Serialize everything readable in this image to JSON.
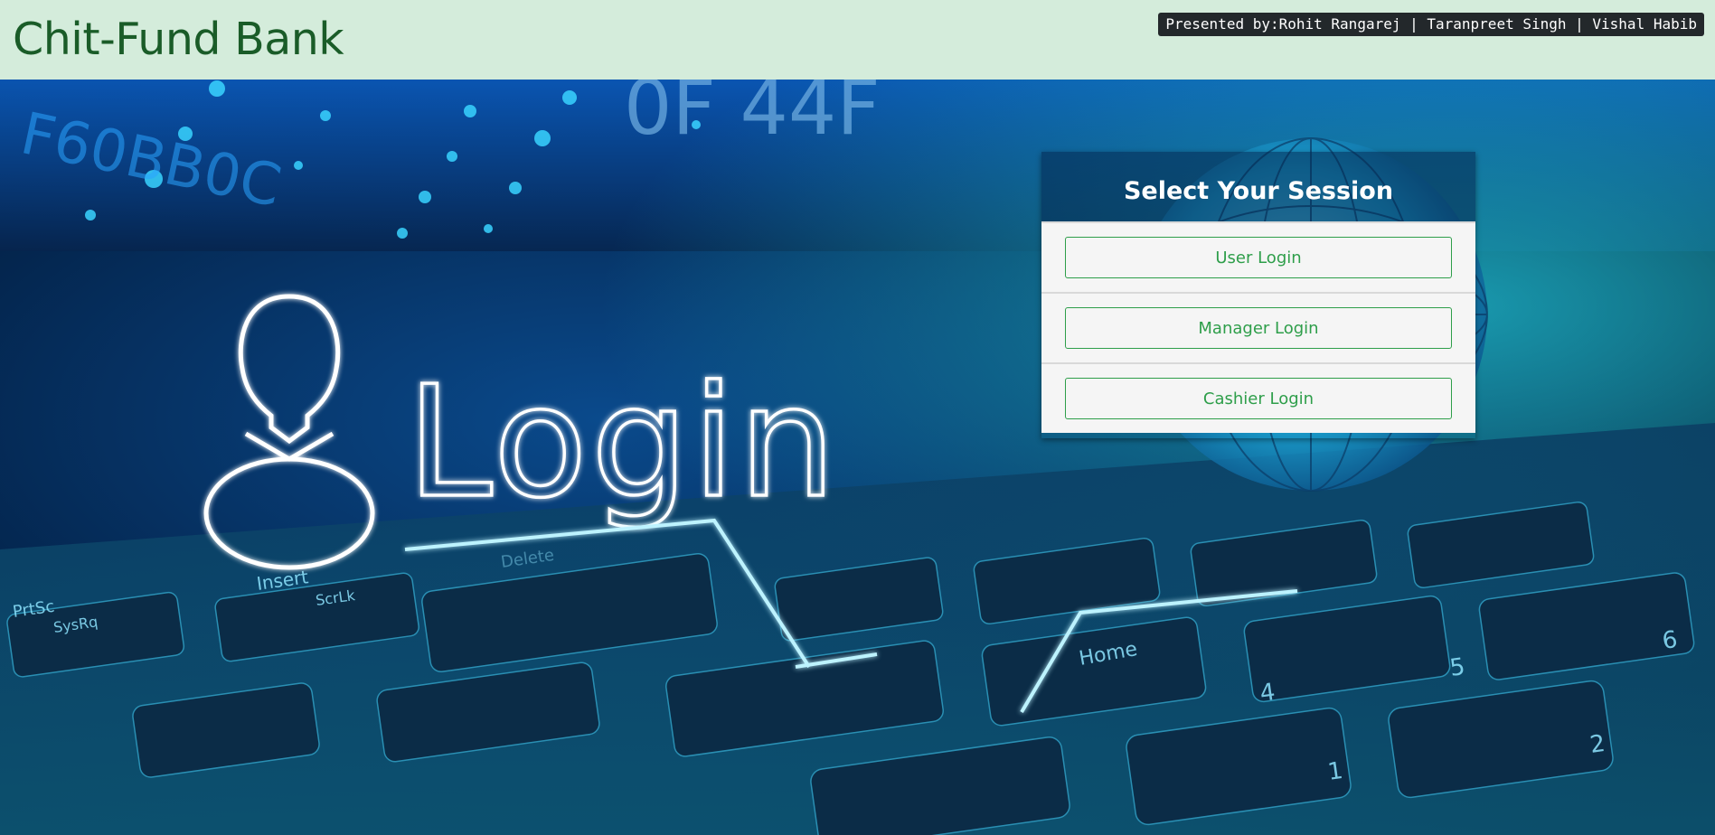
{
  "header": {
    "brand": "Chit-Fund Bank",
    "presenters": "Presented by:Rohit Rangarej | Taranpreet Singh | Vishal Habib"
  },
  "hero": {
    "login_text": "Login",
    "hex_text_1": "F60BB0C",
    "hex_text_2": "0F 44F",
    "key_insert": "Insert",
    "key_scrlk": "ScrLk",
    "key_prtsc": "PrtSc",
    "key_sysrq": "SysRq",
    "key_home": "Home",
    "key_delete": "Delete",
    "key_num4": "4",
    "key_num5": "5",
    "key_num6": "6",
    "key_num1": "1",
    "key_num2": "2"
  },
  "session": {
    "title": "Select Your Session",
    "buttons": [
      {
        "label": "User Login"
      },
      {
        "label": "Manager Login"
      },
      {
        "label": "Cashier Login"
      }
    ]
  },
  "colors": {
    "topbar_bg": "#d4ecdb",
    "brand_text": "#1a5c28",
    "button_accent": "#2e9e4a",
    "panel_bg": "#f5f5f5"
  }
}
